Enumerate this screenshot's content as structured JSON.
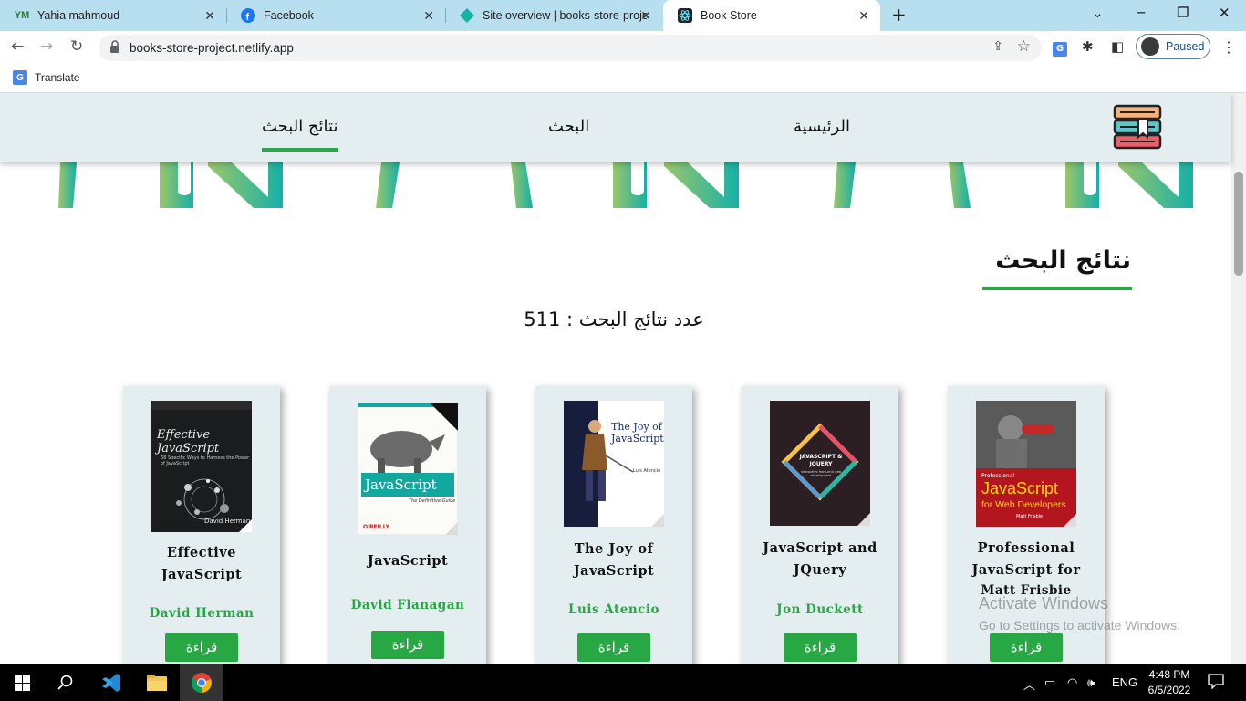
{
  "browser": {
    "tabs": [
      {
        "label": "Yahia mahmoud",
        "icon": "ym-icon"
      },
      {
        "label": "Facebook",
        "icon": "facebook-icon"
      },
      {
        "label": "Site overview | books-store-proje",
        "icon": "netlify-icon"
      },
      {
        "label": "Book Store",
        "icon": "react-icon"
      }
    ],
    "url": "books-store-project.netlify.app",
    "profile_status": "Paused",
    "bookmark": "Translate"
  },
  "site": {
    "nav": {
      "home": "الرئيسية",
      "search": "البحث",
      "results": "نتائج البحث"
    },
    "section_title": "نتائج البحث",
    "result_count_label": "عدد نتائج البحث : 511",
    "read_label": "قراءة",
    "books": [
      {
        "title": "Effective JavaScript",
        "author": "David Herman",
        "cover_title": "Effective JavaScript",
        "cover_sub": "68 Specific Ways to Harness the Power of JavaScript",
        "cover_author": "David Herman"
      },
      {
        "title": "JavaScript",
        "author": "David Flanagan",
        "cover_title": "JavaScript",
        "cover_sub": "The Definitive Guide",
        "cover_pub": "O'REILLY"
      },
      {
        "title": "The Joy of JavaScript",
        "author": "Luis Atencio",
        "cover_title": "The Joy of JavaScript",
        "cover_author": "Luis Atencio"
      },
      {
        "title": "JavaScript and JQuery",
        "author": "Jon Duckett",
        "cover_title": "JAVASCRIPT & JQUERY",
        "cover_sub": "interactive front-end web development"
      },
      {
        "title": "Professional JavaScript for Web Developers",
        "author": "Matt Frisbie",
        "cover_pre": "Professional",
        "cover_title": "JavaScript",
        "cover_sub": "for Web Developers",
        "cover_author": "Matt Frisbie"
      }
    ],
    "accent_color": "#28a745"
  },
  "watermark": {
    "line1": "Activate Windows",
    "line2": "Go to Settings to activate Windows."
  },
  "taskbar": {
    "lang": "ENG",
    "time": "4:48 PM",
    "date": "6/5/2022"
  }
}
